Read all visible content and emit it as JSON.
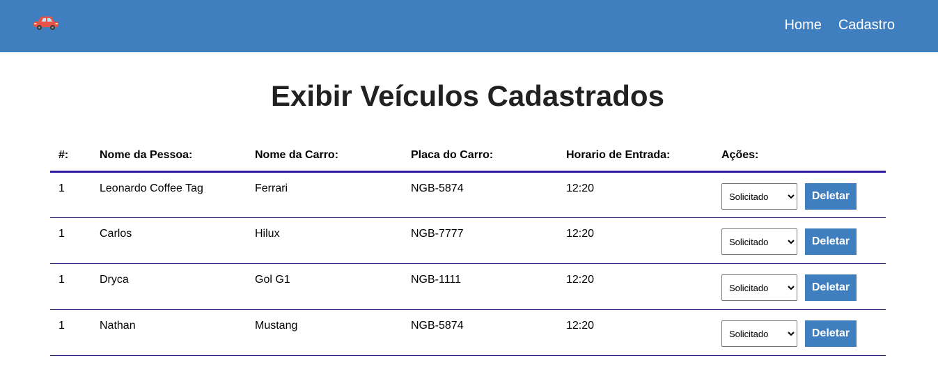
{
  "nav": {
    "logo_icon": "red-car-icon",
    "links": [
      {
        "label": "Home"
      },
      {
        "label": "Cadastro"
      }
    ]
  },
  "title": "Exibir Veículos Cadastrados",
  "table": {
    "headers": [
      "#:",
      "Nome da Pessoa:",
      "Nome da Carro:",
      "Placa do Carro:",
      "Horario de Entrada:",
      "Ações:"
    ],
    "rows": [
      {
        "id": "1",
        "person": "Leonardo Coffee Tag",
        "car": "Ferrari",
        "plate": "NGB-5874",
        "entry_time": "12:20",
        "status": "Solicitado",
        "delete_label": "Deletar"
      },
      {
        "id": "1",
        "person": "Carlos",
        "car": "Hilux",
        "plate": "NGB-7777",
        "entry_time": "12:20",
        "status": "Solicitado",
        "delete_label": "Deletar"
      },
      {
        "id": "1",
        "person": "Dryca",
        "car": "Gol G1",
        "plate": "NGB-1111",
        "entry_time": "12:20",
        "status": "Solicitado",
        "delete_label": "Deletar"
      },
      {
        "id": "1",
        "person": "Nathan",
        "car": "Mustang",
        "plate": "NGB-5874",
        "entry_time": "12:20",
        "status": "Solicitado",
        "delete_label": "Deletar"
      }
    ]
  },
  "colors": {
    "primary": "#3f7fc0",
    "header_border": "#2d1aa0",
    "title_text": "#212121"
  }
}
